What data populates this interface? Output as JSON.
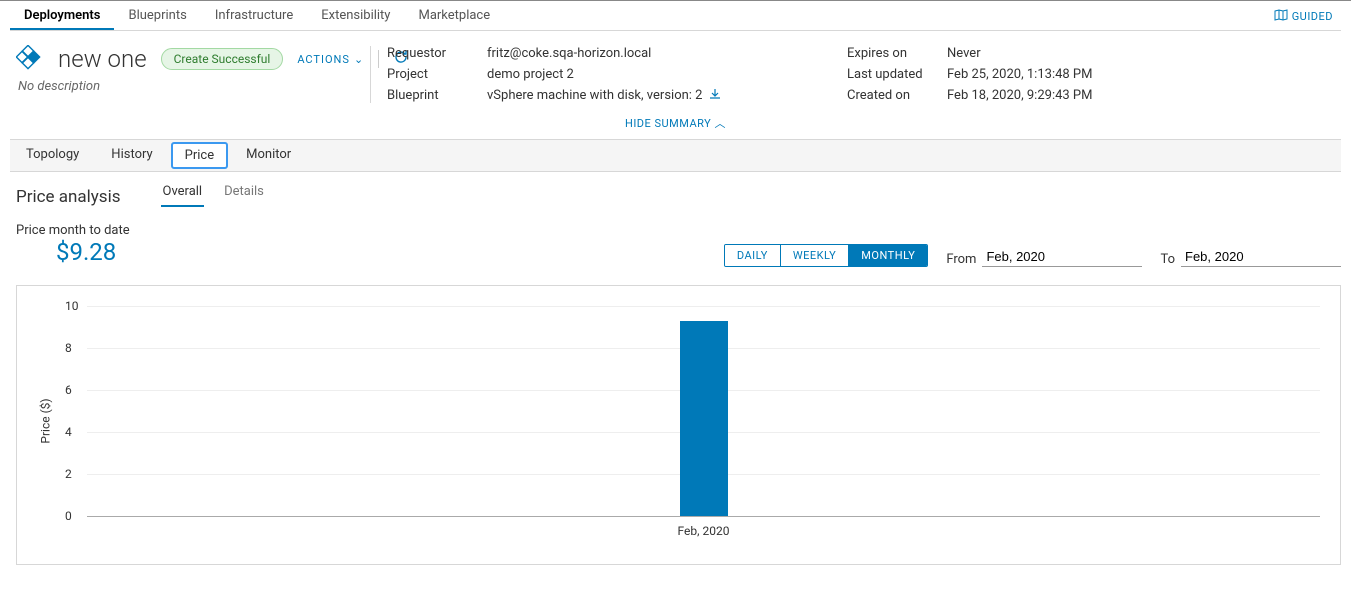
{
  "nav": {
    "tabs": [
      "Deployments",
      "Blueprints",
      "Infrastructure",
      "Extensibility",
      "Marketplace"
    ],
    "active": 0,
    "guided_label": "GUIDED"
  },
  "header": {
    "title": "new one",
    "status_badge": "Create Successful",
    "actions_label": "ACTIONS",
    "description": "No description"
  },
  "summary": {
    "left": [
      {
        "label": "Requestor",
        "value": "fritz@coke.sqa-horizon.local",
        "link": false
      },
      {
        "label": "Project",
        "value": "demo project 2",
        "link": true
      },
      {
        "label": "Blueprint",
        "value": "vSphere machine with disk, version: 2",
        "link": true,
        "download": true
      }
    ],
    "right": [
      {
        "label": "Expires on",
        "value": "Never"
      },
      {
        "label": "Last updated",
        "value": "Feb 25, 2020, 1:13:48 PM"
      },
      {
        "label": "Created on",
        "value": "Feb 18, 2020, 9:29:43 PM"
      }
    ],
    "hide_label": "HIDE SUMMARY"
  },
  "subtabs": {
    "items": [
      "Topology",
      "History",
      "Price",
      "Monitor"
    ],
    "active": 2
  },
  "price_analysis": {
    "title": "Price analysis",
    "subtabs": [
      "Overall",
      "Details"
    ],
    "active_sub": 0,
    "mtd_label": "Price month to date",
    "mtd_value": "$9.28",
    "granularity": {
      "options": [
        "DAILY",
        "WEEKLY",
        "MONTHLY"
      ],
      "active": 2
    },
    "from_label": "From",
    "from_value": "Feb, 2020",
    "to_label": "To",
    "to_value": "Feb, 2020"
  },
  "chart_data": {
    "type": "bar",
    "categories": [
      "Feb, 2020"
    ],
    "values": [
      9.28
    ],
    "xlabel": "",
    "ylabel": "Price ($)",
    "ylim": [
      0,
      10
    ],
    "yticks": [
      0,
      2,
      4,
      6,
      8,
      10
    ]
  }
}
